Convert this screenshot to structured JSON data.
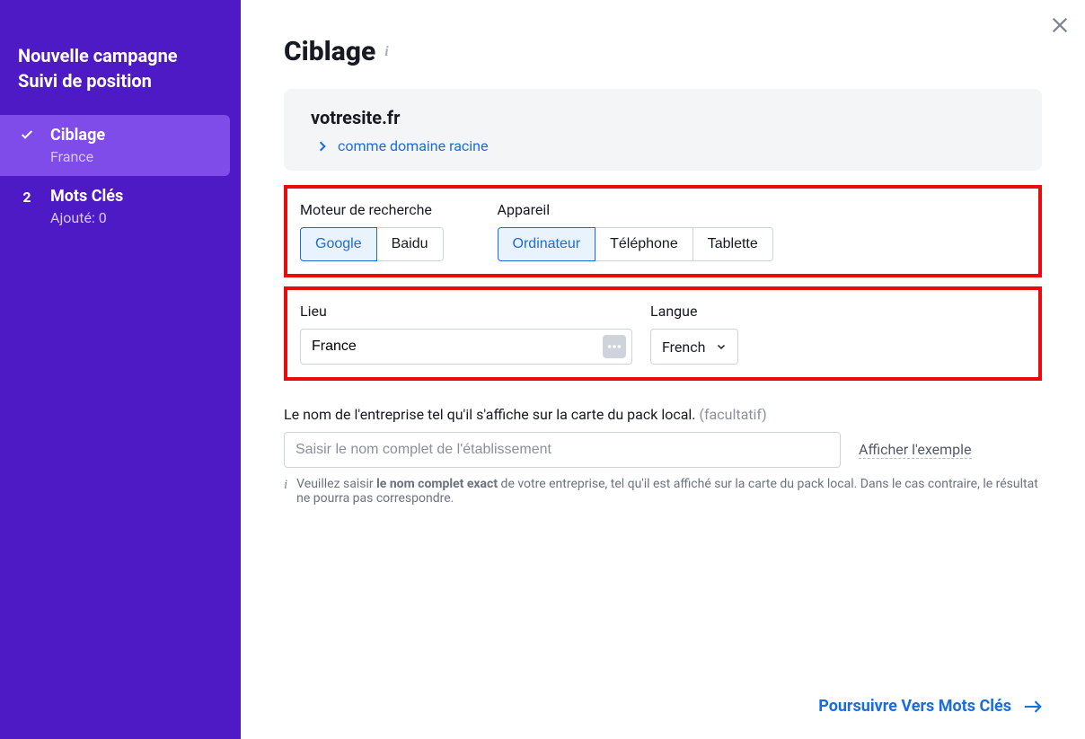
{
  "sidebar": {
    "header_line1": "Nouvelle campagne",
    "header_line2": "Suivi de position",
    "steps": [
      {
        "title": "Ciblage",
        "sub": "France",
        "indicator": "check",
        "active": true
      },
      {
        "title": "Mots Clés",
        "sub": "Ajouté: 0",
        "indicator": "2",
        "active": false
      }
    ]
  },
  "main": {
    "page_title": "Ciblage",
    "domain": {
      "name": "votresite.fr",
      "link_text": "comme domaine racine"
    },
    "search_engine": {
      "label": "Moteur de recherche",
      "options": [
        "Google",
        "Baidu"
      ],
      "selected": "Google"
    },
    "device": {
      "label": "Appareil",
      "options": [
        "Ordinateur",
        "Téléphone",
        "Tablette"
      ],
      "selected": "Ordinateur"
    },
    "location": {
      "label": "Lieu",
      "value": "France"
    },
    "language": {
      "label": "Langue",
      "value": "French"
    },
    "business": {
      "label_main": "Le nom de l'entreprise tel qu'il s'affiche sur la carte du pack local.",
      "label_optional": "(facultatif)",
      "placeholder": "Saisir le nom complet de l'établissement",
      "example_link": "Afficher l'exemple",
      "hint_prefix": "Veuillez saisir ",
      "hint_bold": "le nom complet exact",
      "hint_suffix": " de votre entreprise, tel qu'il est affiché sur la carte du pack local. Dans le cas contraire, le résultat ne pourra pas correspondre."
    },
    "next_button": "Poursuivre Vers Mots Clés"
  }
}
